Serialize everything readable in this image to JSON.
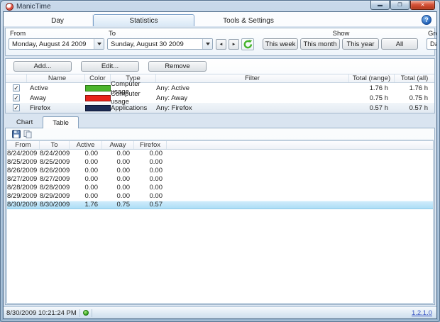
{
  "window": {
    "title": "ManicTime",
    "status": {
      "timestamp": "8/30/2009 10:21:24 PM",
      "version": "1.2.1.0"
    }
  },
  "icons": {
    "minimize": "▬",
    "maximize": "❐",
    "close": "✕",
    "help": "?",
    "check": "✓",
    "prev": "◄",
    "next": "►"
  },
  "main_tabs": {
    "items": [
      {
        "label": "Day",
        "active": false
      },
      {
        "label": "Statistics",
        "active": true
      },
      {
        "label": "Tools & Settings",
        "active": false
      }
    ]
  },
  "date_toolbar": {
    "from": {
      "label": "From",
      "value": "Monday, August 24 2009"
    },
    "to": {
      "label": "To",
      "value": "Sunday, August 30 2009"
    },
    "show": {
      "label": "Show",
      "buttons": [
        "This week",
        "This month",
        "This year",
        "All"
      ]
    },
    "group_by": {
      "label": "Group by",
      "value": "Day"
    }
  },
  "filter_section": {
    "add_label": "Add...",
    "edit_label": "Edit...",
    "remove_label": "Remove",
    "columns": [
      "Name",
      "Color",
      "Type",
      "Filter",
      "Total (range)",
      "Total (all)"
    ],
    "rows": [
      {
        "checked": true,
        "name": "Active",
        "color": "#4cb52c",
        "border": "#2e7a17",
        "type": "Computer usage",
        "filter": "Any: Active",
        "total_range": "1.76 h",
        "total_all": "1.76 h",
        "selected": false
      },
      {
        "checked": true,
        "name": "Away",
        "color": "#e8231b",
        "border": "#8f120c",
        "type": "Computer usage",
        "filter": "Any: Away",
        "total_range": "0.75 h",
        "total_all": "0.75 h",
        "selected": false
      },
      {
        "checked": true,
        "name": "Firefox",
        "color": "#1c2b55",
        "border": "#0c1430",
        "type": "Applications",
        "filter": "Any: Firefox",
        "total_range": "0.57 h",
        "total_all": "0.57 h",
        "selected": true
      }
    ]
  },
  "view_section": {
    "tabs": [
      {
        "label": "Chart",
        "active": false
      },
      {
        "label": "Table",
        "active": true
      }
    ],
    "table": {
      "columns": [
        "From",
        "To",
        "Active",
        "Away",
        "Firefox"
      ],
      "rows": [
        {
          "from": "8/24/2009",
          "to": "8/24/2009",
          "active": "0.00",
          "away": "0.00",
          "firefox": "0.00",
          "selected": false
        },
        {
          "from": "8/25/2009",
          "to": "8/25/2009",
          "active": "0.00",
          "away": "0.00",
          "firefox": "0.00",
          "selected": false
        },
        {
          "from": "8/26/2009",
          "to": "8/26/2009",
          "active": "0.00",
          "away": "0.00",
          "firefox": "0.00",
          "selected": false
        },
        {
          "from": "8/27/2009",
          "to": "8/27/2009",
          "active": "0.00",
          "away": "0.00",
          "firefox": "0.00",
          "selected": false
        },
        {
          "from": "8/28/2009",
          "to": "8/28/2009",
          "active": "0.00",
          "away": "0.00",
          "firefox": "0.00",
          "selected": false
        },
        {
          "from": "8/29/2009",
          "to": "8/29/2009",
          "active": "0.00",
          "away": "0.00",
          "firefox": "0.00",
          "selected": false
        },
        {
          "from": "8/30/2009",
          "to": "8/30/2009",
          "active": "1.76",
          "away": "0.75",
          "firefox": "0.57",
          "selected": true
        }
      ]
    }
  },
  "colors": {
    "selection_row": "#a9dcf5",
    "refresh_green": "#45b42c",
    "frame_blue": "#a9c2dc",
    "help_blue": "#1d5cb4"
  }
}
